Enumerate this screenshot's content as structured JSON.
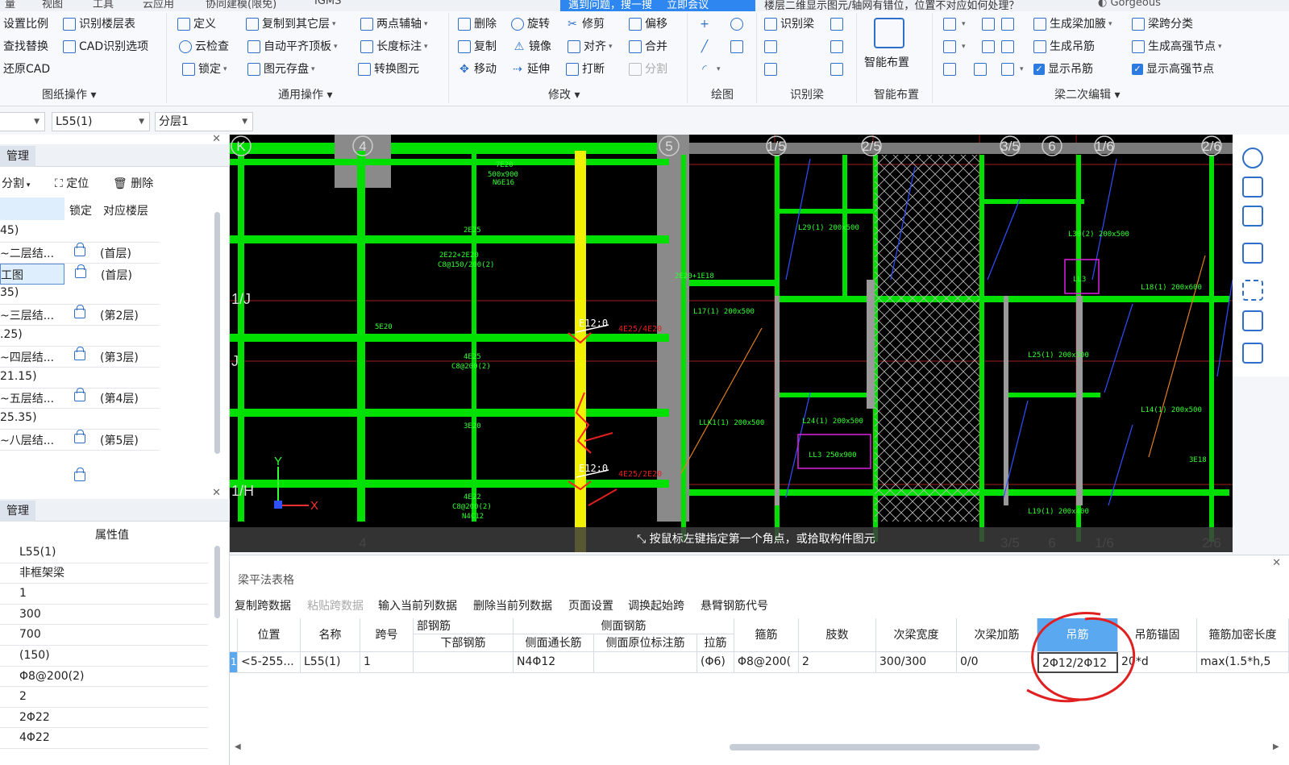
{
  "menu": [
    "量",
    "视图",
    "工具",
    "云应用",
    "协同建模(限免)",
    "IGMS"
  ],
  "notice": {
    "text": "遇到问题，搜一搜",
    "button": "立即会议"
  },
  "question": "楼层二维显示图元/轴网有错位，位置不对应如何处理？",
  "user": "Gorgeous",
  "ribbon": {
    "drawing_ops": {
      "label": "图纸操作",
      "items": [
        "设置比例",
        "识别楼层表",
        "查找替换",
        "CAD识别选项",
        "还原CAD"
      ]
    },
    "general_ops": {
      "label": "通用操作",
      "items": [
        "定义",
        "复制到其它层",
        "两点辅轴",
        "云检查",
        "自动平齐顶板",
        "长度标注",
        "锁定",
        "图元存盘",
        "转换图元"
      ]
    },
    "modify": {
      "label": "修改",
      "items": [
        "删除",
        "旋转",
        "修剪",
        "偏移",
        "复制",
        "镜像",
        "对齐",
        "合并",
        "移动",
        "延伸",
        "打断",
        "分割"
      ]
    },
    "draw": {
      "label": "绘图"
    },
    "recognize_beam": {
      "label": "识别梁",
      "items": [
        "识别梁"
      ]
    },
    "smart_layout": {
      "label": "智能布置",
      "items": [
        "智能布置"
      ]
    },
    "beam_edit": {
      "label": "梁二次编辑",
      "items": [
        "生成梁加腋",
        "梁跨分类",
        "生成吊筋",
        "生成高强节点",
        "显示吊筋",
        "显示高强节点"
      ]
    }
  },
  "selectors": {
    "beam": "L55(1)",
    "layer": "分层1"
  },
  "left_panel": {
    "tab": "管理",
    "tools": [
      "分割",
      "定位",
      "删除"
    ],
    "columns": [
      "锁定",
      "对应楼层"
    ],
    "rows": [
      {
        "name": "45)",
        "floor": ""
      },
      {
        "name": "~二层结...",
        "floor": "(首层)"
      },
      {
        "name": "工图",
        "floor": "(首层)"
      },
      {
        "name": "35)",
        "floor": ""
      },
      {
        "name": "~三层结...",
        "floor": "(第2层)"
      },
      {
        "name": ".25)",
        "floor": ""
      },
      {
        "name": "~四层结...",
        "floor": "(第3层)"
      },
      {
        "name": "21.15)",
        "floor": ""
      },
      {
        "name": "~五层结...",
        "floor": "(第4层)"
      },
      {
        "name": "25.35)",
        "floor": ""
      },
      {
        "name": "~八层结...",
        "floor": "(第5层)"
      }
    ],
    "props_tab": "管理",
    "props_header": "属性值",
    "props": [
      "L55(1)",
      "非框架梁",
      "1",
      "300",
      "700",
      "(150)",
      "Φ8@200(2)",
      "2",
      "2Φ22",
      "4Φ22"
    ]
  },
  "cad": {
    "axis_top": [
      "K",
      "4",
      "5",
      "1/5",
      "2/5",
      "3/5",
      "6",
      "1/6",
      "2/6"
    ],
    "axis_left": [
      "1/J",
      "J",
      "1/H"
    ],
    "annotations": {
      "a1": "E12;0",
      "a2": "4E25/4E20",
      "a3": "E12;0",
      "a4": "4E25/2E20",
      "b1": "7E20",
      "b2": "500x900",
      "b3": "N6E16",
      "c1": "2E25",
      "c2": "2E22+2E20",
      "c3": "C8@150/200(2)",
      "d1": "4E25",
      "d2": "C8@200(2)",
      "e1": "3E20",
      "e2": "5E20",
      "f1": "4E22",
      "f2": "C8@200(2)",
      "f3": "N4C12",
      "g1": "L29(1) 200x500",
      "g2": "L30(2) 200x500",
      "g3": "L17(1) 200x500",
      "g4": "L25(1) 200x500",
      "g5": "L24(1) 200x500",
      "g6": "LL3 250x900",
      "g7": "L18(1) 200x600",
      "g8": "L14(1) 200x500",
      "g9": "LL3",
      "g10": "LLK1(1) 200x500",
      "g11": "L19(1) 200x400",
      "g12": "2E20+1E18",
      "g13": "3E18",
      "axis_x": "X",
      "axis_y": "Y"
    },
    "prompt": "按鼠标左键指定第一个角点，或拾取构件图元"
  },
  "beam_table": {
    "title": "梁平法表格",
    "buttons": [
      "复制跨数据",
      "粘贴跨数据",
      "输入当前列数据",
      "删除当前列数据",
      "页面设置",
      "调换起始跨",
      "悬臂钢筋代号"
    ],
    "group_headers": {
      "bottom": "部钢筋",
      "side": "侧面钢筋"
    },
    "headers": {
      "position": "位置",
      "name": "名称",
      "span": "跨号",
      "bottom_bar": "下部钢筋",
      "side_through": "侧面通长筋",
      "side_mark": "侧面原位标注筋",
      "tie": "拉筋",
      "stirrup": "箍筋",
      "legs": "肢数",
      "sec_width": "次梁宽度",
      "sec_add": "次梁加筋",
      "hanger": "吊筋",
      "hanger_anchor": "吊筋锚固",
      "stirrup_dense": "箍筋加密长度"
    },
    "row": {
      "index": "1",
      "position": "<5-255...",
      "name": "L55(1)",
      "span": "1",
      "bottom_bar": "",
      "side_through": "N4Φ12",
      "side_mark": "",
      "tie": "(Φ6)",
      "stirrup": "Φ8@200(",
      "legs": "2",
      "sec_width": "300/300",
      "sec_add": "0/0",
      "hanger": "2Φ12/2Φ12",
      "hanger_anchor": "20*d",
      "stirrup_dense": "max(1.5*h,5"
    }
  },
  "colors": {
    "accent": "#2e86f0",
    "beam_green": "#00e000",
    "highlight_yellow": "#f0f000",
    "annotation_red": "#e02020"
  }
}
